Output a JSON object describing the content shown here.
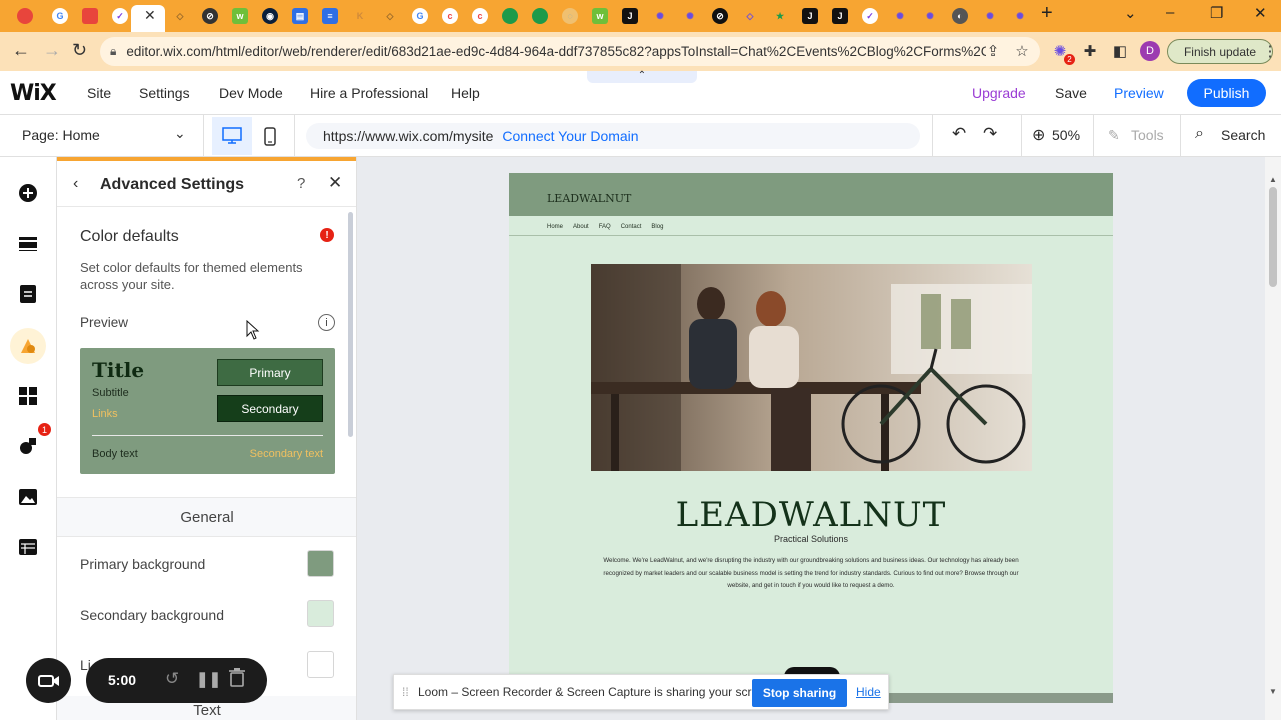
{
  "browser": {
    "url": "editor.wix.com/html/editor/web/renderer/edit/683d21ae-ed9c-4d84-964a-ddf737855c82?appsToInstall=Chat%2CEvents%2CBlog%2CForms%2Cb...",
    "profile_initial": "D",
    "extension_badge": "2",
    "finish_update": "Finish update",
    "accent": "#f7a532"
  },
  "wix": {
    "logo": "WiX",
    "menu": [
      "Site",
      "Settings",
      "Dev Mode",
      "Hire a Professional",
      "Help"
    ],
    "upgrade": "Upgrade",
    "save": "Save",
    "preview": "Preview",
    "publish": "Publish",
    "page_selector": "Page: Home",
    "site_url": "https://www.wix.com/mysite",
    "connect_domain": "Connect Your Domain",
    "zoom": "50%",
    "tools": "Tools",
    "search": "Search",
    "brand_color": "#116dff"
  },
  "rail": {
    "badge": "1"
  },
  "panel": {
    "title": "Advanced Settings",
    "color_defaults": {
      "title": "Color defaults",
      "alert": "!",
      "description": "Set color defaults for themed elements across your site."
    },
    "preview": {
      "label": "Preview",
      "title": "Title",
      "subtitle": "Subtitle",
      "links": "Links",
      "primary": "Primary",
      "secondary": "Secondary",
      "body": "Body text",
      "secondary_text": "Secondary text"
    },
    "general": {
      "header": "General",
      "rows": [
        {
          "label": "Primary background",
          "color": "#7f9b7f"
        },
        {
          "label": "Secondary background",
          "color": "#d9ecdc"
        },
        {
          "label": "Li",
          "color": "#ffffff"
        }
      ]
    },
    "text_header": "Text"
  },
  "site": {
    "logo": "LEADWALNUT",
    "nav": [
      "Home",
      "About",
      "FAQ",
      "Contact",
      "Blog"
    ],
    "heading": "LEADWALNUT",
    "subheading": "Practical Solutions",
    "paragraph": "Welcome. We're LeadWalnut, and we're disrupting the industry with our groundbreaking solutions and business ideas. Our technology has already been recognized by market leaders and our scalable business model is setting the trend for industry standards. Curious to find out more? Browse through our website, and get in touch if you would like to request a demo."
  },
  "loom": {
    "timer": "5:00",
    "message": "Loom – Screen Recorder & Screen Capture is sharing your screen.",
    "stop": "Stop sharing",
    "hide": "Hide"
  }
}
